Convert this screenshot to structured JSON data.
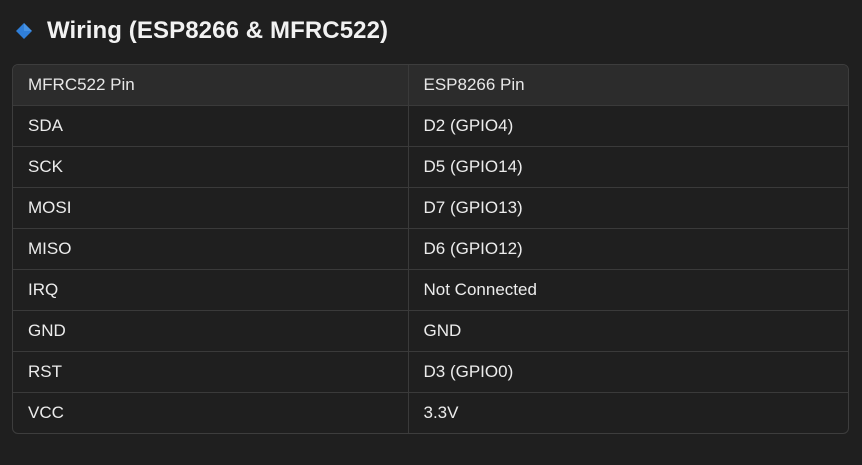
{
  "section": {
    "title": "Wiring (ESP8266 & MFRC522)",
    "icon": "blue-diamond-icon",
    "icon_color": "#2f7ed8"
  },
  "table": {
    "headers": [
      "MFRC522 Pin",
      "ESP8266 Pin"
    ],
    "rows": [
      [
        "SDA",
        "D2 (GPIO4)"
      ],
      [
        "SCK",
        "D5 (GPIO14)"
      ],
      [
        "MOSI",
        "D7 (GPIO13)"
      ],
      [
        "MISO",
        "D6 (GPIO12)"
      ],
      [
        "IRQ",
        "Not Connected"
      ],
      [
        "GND",
        "GND"
      ],
      [
        "RST",
        "D3 (GPIO0)"
      ],
      [
        "VCC",
        "3.3V"
      ]
    ]
  }
}
